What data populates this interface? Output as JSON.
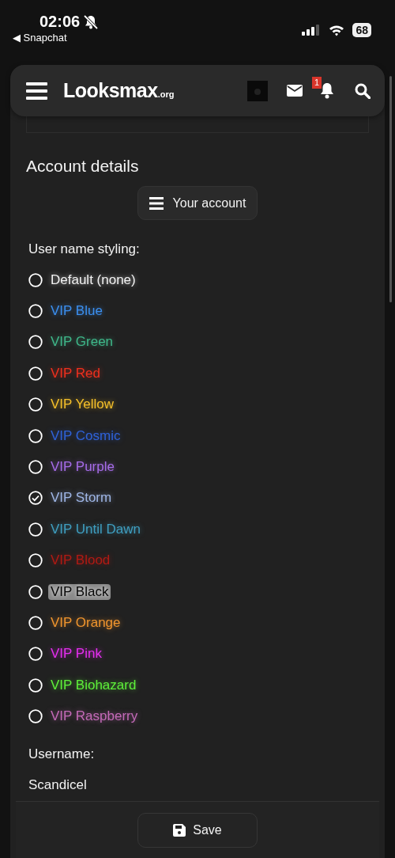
{
  "status_bar": {
    "time": "02:06",
    "back_app": "◀ Snapchat",
    "battery": "68"
  },
  "header": {
    "logo": "Looksmax",
    "logo_suffix": ".org",
    "notification_count": "1"
  },
  "page_title": "Account details",
  "account_button": "Your account",
  "styling": {
    "label": "User name styling:",
    "options": [
      {
        "label": "Default (none)",
        "color": "#f2f2f2",
        "selected": false
      },
      {
        "label": "VIP Blue",
        "color": "#3b8ff0",
        "selected": false
      },
      {
        "label": "VIP Green",
        "color": "#3fb88a",
        "selected": false
      },
      {
        "label": "VIP Red",
        "color": "#f0301e",
        "selected": false
      },
      {
        "label": "VIP Yellow",
        "color": "#f5c02a",
        "selected": false
      },
      {
        "label": "VIP Cosmic",
        "color": "#2f62d8",
        "selected": false
      },
      {
        "label": "VIP Purple",
        "color": "#a66ce8",
        "selected": false
      },
      {
        "label": "VIP Storm",
        "color": "#9fb6e6",
        "selected": true
      },
      {
        "label": "VIP Until Dawn",
        "color": "#3f9ec0",
        "selected": false
      },
      {
        "label": "VIP Blood",
        "color": "#b01a14",
        "selected": false
      },
      {
        "label": "VIP Black",
        "color": "#050505",
        "selected": false
      },
      {
        "label": "VIP Orange",
        "color": "#f0952e",
        "selected": false
      },
      {
        "label": "VIP Pink",
        "color": "#e62ef0",
        "selected": false
      },
      {
        "label": "VIP Biohazard",
        "color": "#5ef03a",
        "selected": false
      },
      {
        "label": "VIP Raspberry",
        "color": "#c46ab8",
        "selected": false
      }
    ]
  },
  "username": {
    "label": "Username:",
    "value": "Scandicel"
  },
  "save_button": "Save"
}
